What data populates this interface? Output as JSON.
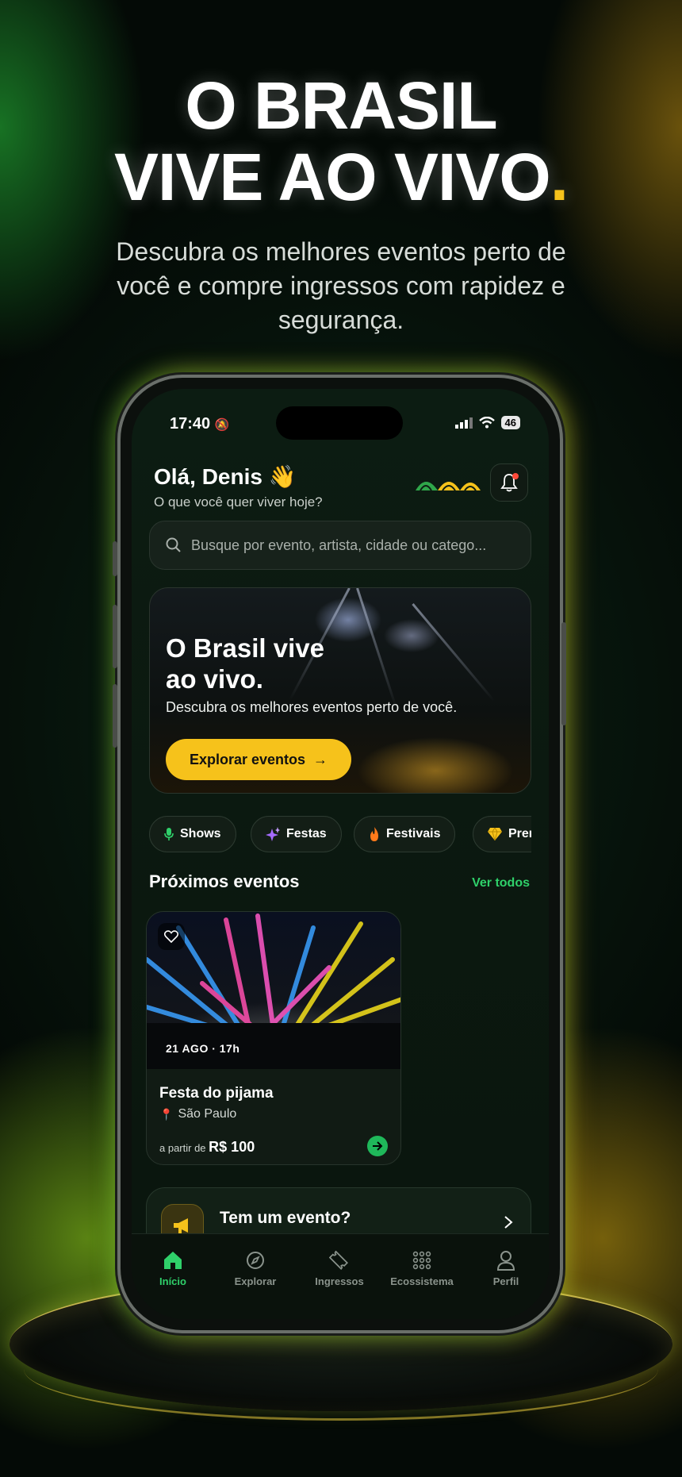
{
  "hero": {
    "title_line1": "O BRASIL",
    "title_line2": "VIVE AO VIVO",
    "title_dot": ".",
    "subtitle": "Descubra os melhores eventos perto de você e compre ingressos com rapidez e segurança."
  },
  "status_bar": {
    "time": "17:40",
    "battery": "46"
  },
  "header": {
    "greeting": "Olá, Denis 👋",
    "subtitle": "O que você quer viver hoje?"
  },
  "search": {
    "placeholder": "Busque por evento, artista, cidade ou catego..."
  },
  "banner": {
    "title": "O Brasil vive ao vivo.",
    "subtitle": "Descubra os melhores eventos perto de você.",
    "button_label": "Explorar eventos",
    "button_arrow": "→"
  },
  "categories": [
    {
      "label": "Shows",
      "icon": "microphone-icon"
    },
    {
      "label": "Festas",
      "icon": "sparkles-icon"
    },
    {
      "label": "Festivais",
      "icon": "fire-icon"
    },
    {
      "label": "Premi",
      "icon": "diamond-icon"
    }
  ],
  "upcoming": {
    "title": "Próximos eventos",
    "see_all": "Ver todos",
    "events": [
      {
        "date": "21 AGO · 17h",
        "name": "Festa do pijama",
        "location": "São Paulo",
        "price_prefix": "a partir de",
        "price": "R$ 100"
      }
    ]
  },
  "cta": {
    "title": "Tem um evento?"
  },
  "tabbar": [
    {
      "label": "Início",
      "icon": "home-icon",
      "active": true
    },
    {
      "label": "Explorar",
      "icon": "compass-icon",
      "active": false
    },
    {
      "label": "Ingressos",
      "icon": "ticket-icon",
      "active": false
    },
    {
      "label": "Ecossistema",
      "icon": "grid-icon",
      "active": false
    },
    {
      "label": "Perfil",
      "icon": "user-icon",
      "active": false
    }
  ],
  "colors": {
    "accent_green": "#2fd06a",
    "accent_yellow": "#f6c21b",
    "background": "#030805"
  }
}
